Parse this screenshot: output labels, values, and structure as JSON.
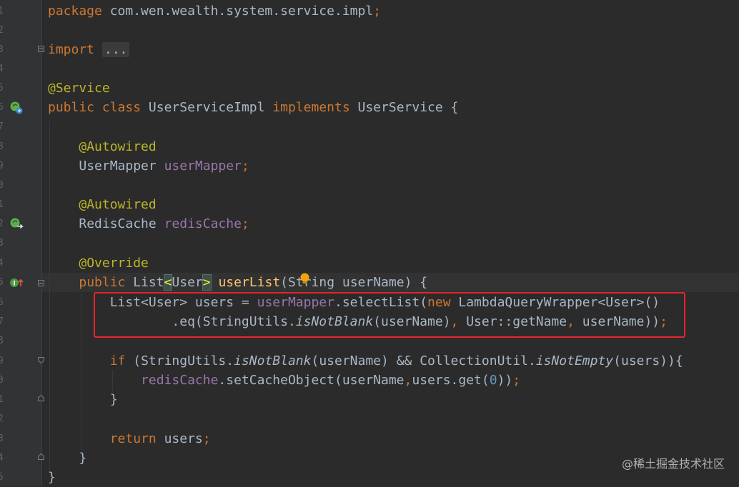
{
  "lines": [
    {
      "n": "1"
    },
    {
      "n": "2"
    },
    {
      "n": "3"
    },
    {
      "n": "4"
    },
    {
      "n": "5"
    },
    {
      "n": "6"
    },
    {
      "n": "7"
    },
    {
      "n": "8"
    },
    {
      "n": "9"
    },
    {
      "n": "0"
    },
    {
      "n": "1"
    },
    {
      "n": "2"
    },
    {
      "n": "3"
    },
    {
      "n": "4"
    },
    {
      "n": "5"
    },
    {
      "n": "6"
    },
    {
      "n": "7"
    },
    {
      "n": "8"
    },
    {
      "n": "9"
    },
    {
      "n": "0"
    },
    {
      "n": "1"
    },
    {
      "n": "2"
    },
    {
      "n": "3"
    },
    {
      "n": "4"
    },
    {
      "n": "5"
    }
  ],
  "code": {
    "l1_kw": "package",
    "l1_rest": " com.wen.wealth.system.service.impl",
    "l1_semi": ";",
    "l3_kw": "import",
    "l3_fold": "...",
    "l5_ann": "@Service",
    "l6_kw1": "public",
    "l6_kw2": "class",
    "l6_name": " UserServiceImpl ",
    "l6_kw3": "implements",
    "l6_rest": " UserService {",
    "l8_ann": "@Autowired",
    "l9_type": "UserMapper ",
    "l9_field": "userMapper",
    "l9_semi": ";",
    "l11_ann": "@Autowired",
    "l12_type": "RedisCache ",
    "l12_field": "redisCache",
    "l12_semi": ";",
    "l14_ann": "@Override",
    "l15_kw": "public",
    "l15_t1": " List",
    "l15_lt": "<",
    "l15_user": "User",
    "l15_gt": ">",
    "l15_sp": " ",
    "l15_fn": "userList",
    "l15_rest": "(String userName) {",
    "l16_a": "List<User> users = ",
    "l16_field": "userMapper",
    "l16_b": ".selectList(",
    "l16_kw": "new",
    "l16_c": " LambdaQueryWrapper<User>()",
    "l17_a": ".eq(StringUtils.",
    "l17_it": "isNotBlank",
    "l17_b": "(userName)",
    "l17_comma1": ",",
    "l17_c": " User::getName",
    "l17_comma2": ",",
    "l17_d": " userName))",
    "l17_semi": ";",
    "l19_kw": "if",
    "l19_a": " (StringUtils.",
    "l19_it1": "isNotBlank",
    "l19_b": "(userName) && CollectionUtil.",
    "l19_it2": "isNotEmpty",
    "l19_c": "(users)){",
    "l20_field": "redisCache",
    "l20_a": ".setCacheObject(userName",
    "l20_comma": ",",
    "l20_b": "users.get(",
    "l20_num": "0",
    "l20_c": "))",
    "l20_semi": ";",
    "l21_brace": "}",
    "l23_kw": "return",
    "l23_a": " users",
    "l23_semi": ";",
    "l24_brace": "}",
    "l25_brace": "}"
  },
  "gutter_icons": {
    "l6": "spring-bean-implementation-icon",
    "l12": "spring-bean-navigate-icon",
    "l15": "override-method-icon"
  },
  "watermark": "@稀土掘金技术社区",
  "colors": {
    "background": "#2b2b2b",
    "keyword": "#cc7832",
    "annotation": "#bbb529",
    "field": "#9876aa",
    "method": "#ffc66d",
    "number": "#6897bb",
    "highlight_box": "#e8242b"
  }
}
